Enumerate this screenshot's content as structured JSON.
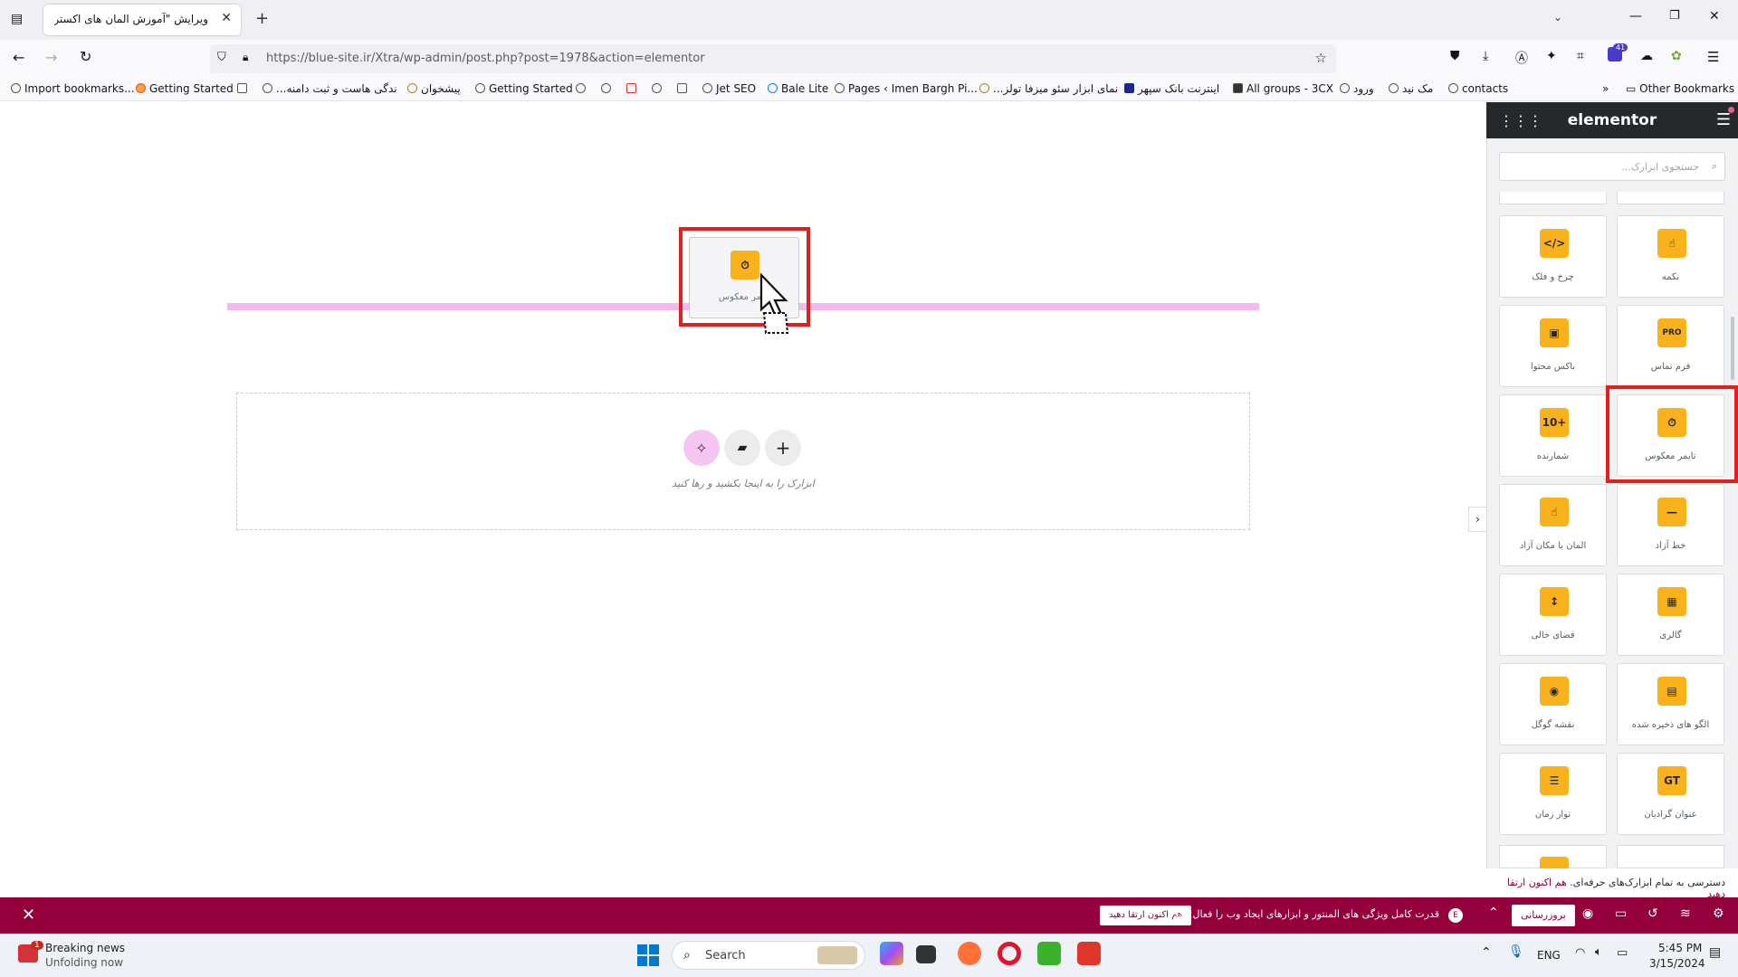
{
  "browser": {
    "tab_title": "ویرایش \"آموزش المان های اکسترا – ا",
    "url": "https://blue-site.ir/Xtra/wp-admin/post.php?post=1978&action=elementor",
    "extensions_badge": "41",
    "bookmarks": [
      "Import bookmarks...",
      "Getting Started",
      "...ندگی هاست و ثبت دامنه",
      "پیشخوان",
      "Getting Started",
      "Jet SEO",
      "Bale Lite",
      "Pages ‹ Imen Bargh Pi...",
      "...نمای ابزار سئو میزفا تولز",
      "اینترنت بانک سپهر",
      "All groups - 3CX",
      "ورود",
      "مک نید",
      "contacts"
    ],
    "other_bookmarks": "Other Bookmarks"
  },
  "canvas": {
    "drag_widget_label": "تایمر معکوس",
    "drop_instruction": "ابزارک را به اینجا بکشید و رها کنید"
  },
  "panel": {
    "brand": "elementor",
    "search_placeholder": "جستجوی ابزارک...",
    "widgets": [
      {
        "label": "نکمه",
        "icon": "button-icon",
        "glyph": "☝"
      },
      {
        "label": "چرخ و فلک",
        "icon": "code-icon",
        "glyph": "</>"
      },
      {
        "label": "فرم تماس",
        "icon": "pro-form-icon",
        "glyph": "PRO"
      },
      {
        "label": "باکس محتوا",
        "icon": "content-box-icon",
        "glyph": "▣"
      },
      {
        "label": "تایمر معکوس",
        "icon": "timer-icon",
        "glyph": "⏱"
      },
      {
        "label": "شمارنده",
        "icon": "counter-icon",
        "glyph": "10+"
      },
      {
        "label": "خط آزاد",
        "icon": "divider-icon",
        "glyph": "—"
      },
      {
        "label": "المان با مکان آزاد",
        "icon": "free-position-icon",
        "glyph": "☝"
      },
      {
        "label": "گالری",
        "icon": "gallery-icon",
        "glyph": "▦"
      },
      {
        "label": "فضای خالی",
        "icon": "spacer-icon",
        "glyph": "↕"
      },
      {
        "label": "الگو های ذخیره شده",
        "icon": "saved-template-icon",
        "glyph": "▤"
      },
      {
        "label": "نقشه گوگل",
        "icon": "map-pin-icon",
        "glyph": "◉"
      },
      {
        "label": "عنوان گرادیان",
        "icon": "gradient-title-icon",
        "glyph": "GT"
      },
      {
        "label": "نوار زمان",
        "icon": "timeline-icon",
        "glyph": "☰"
      }
    ],
    "upsell_text": "دسترسی به تمام ابزارک‌های حرفه‌ای.",
    "upsell_link": "هم اکنون ارتقا دهید"
  },
  "notice": {
    "text": "قدرت کامل ویژگی های المنتور و ابزارهای ایجاد وب را فعال کنید.",
    "cta": "هم اکنون ارتقا دهید",
    "publish": "بروزرسانی"
  },
  "taskbar": {
    "news_title": "Breaking news",
    "news_sub": "Unfolding now",
    "news_badge": "1",
    "search_placeholder": "Search",
    "language": "ENG",
    "time": "5:45 PM",
    "date": "3/15/2024"
  },
  "colors": {
    "accent_magenta": "#93003c",
    "widget_yellow": "#f9b21b",
    "highlight_red": "#e02020",
    "drop_line_pink": "#f3b9ef"
  }
}
